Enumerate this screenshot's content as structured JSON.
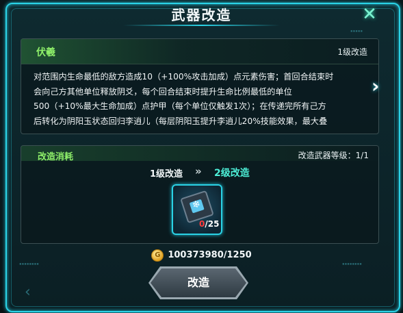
{
  "window": {
    "title": "武器改造"
  },
  "weapon": {
    "name": "伏羲",
    "level_label": "1级改造",
    "description_lines": [
      "对范围内生命最低的敌方造成10（+100%攻击加成）点元素伤害；首回合结束时",
      "会向己方其他单位释放阴爻，每个回合结束时提升生命比例最低的单位",
      "500（+10%最大生命加成）点护甲（每个单位仅触发1次）；在传递完所有己方",
      "后转化为阴阳玉状态回归李逍儿（每层阴阳玉提升李逍儿20%技能效果，最大叠"
    ]
  },
  "cost": {
    "title": "改造消耗",
    "weapon_level": "改造武器等级：1/1",
    "from_level": "1级改造",
    "arrow": "»",
    "to_level": "2级改造",
    "item": {
      "have": "0",
      "need": "/25",
      "icon": "chip-icon"
    }
  },
  "currency": {
    "icon": "gold-coin-icon",
    "amount": "100373980/1250"
  },
  "buttons": {
    "confirm": "改造",
    "close": "✕",
    "next": "›",
    "prev": "‹"
  }
}
